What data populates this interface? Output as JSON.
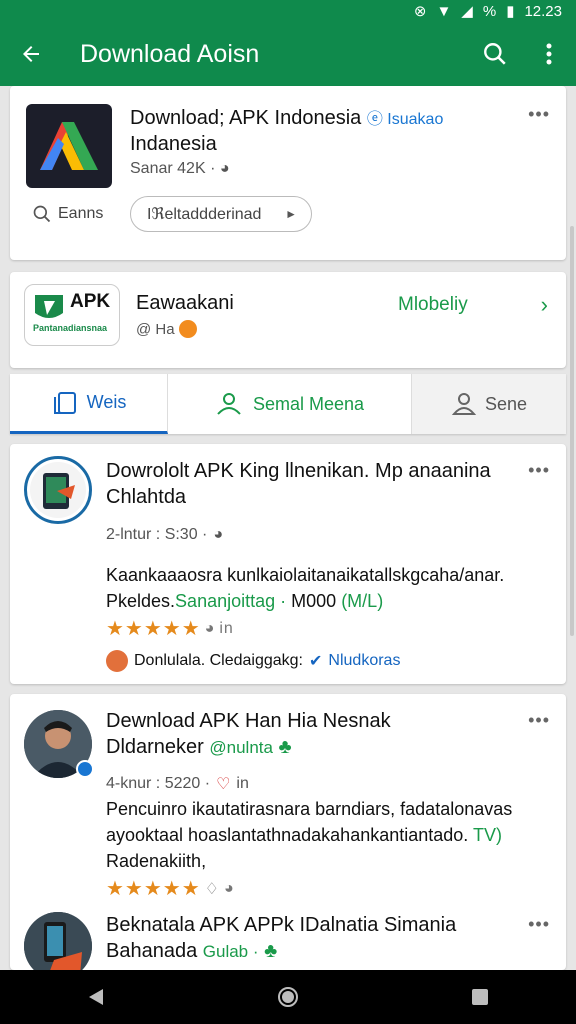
{
  "status_bar": {
    "time": "12.23",
    "battery_label": "%"
  },
  "app_bar": {
    "title": "Download Aoisn"
  },
  "app_card": {
    "name_line1": "Download; APK Indonesia",
    "badge_text": "Isuakao",
    "name_line2": "Indanesia",
    "meta": "Sanar 42K",
    "search_label": "Eanns",
    "chip_label": "Iℜeltaddderinad"
  },
  "brand_card": {
    "logo_text": "APK",
    "logo_subtext": "Pantanadiansnaa",
    "name": "Eawaakani",
    "sub": "@ Ha",
    "right_label": "Mlobeliy"
  },
  "tabs": [
    {
      "label": "Weis"
    },
    {
      "label": "Semal Meena"
    },
    {
      "label": "Sene"
    }
  ],
  "posts": [
    {
      "title_line1": "Dowrololt APK King llnenikan. Mp anaanina",
      "title_line2": "Chlahtda",
      "meta": "2-lntur : S:30 ·",
      "body_line1": "Kaankaaaosra kunlkaiolaitanaikatallskgcaha/anar.",
      "body_line2_pre": "Pkeldes.",
      "body_line2_green": "Sananjoittag ·",
      "body_line2_post": "M000",
      "body_line2_tail": "(M/L)",
      "stars": "★★★★★",
      "stars_tail": "in",
      "footer_text": "Donlulala. Cledaiggakg:",
      "footer_link": "Nludkoras"
    },
    {
      "title_line1": "Dewnload APK Han Hia Nesnak",
      "title_line2_pre": "Dldarneker",
      "title_line2_green": "@nulnta",
      "meta": "4-knur : 5220 ·",
      "meta_tail": "in",
      "body_line1": "Pencuinro ikautatirasnara barndiars, fadatalonavas",
      "body_line2": "ayooktaal hoaslantathnadakahankantiantado.",
      "body_line2_green": "TV)",
      "body_line3": "Radenakiith,",
      "stars": "★★★★★"
    },
    {
      "title_line1": "Beknatala APK APPk IDalnatia Simania",
      "title_line2_pre": "Bahanada",
      "title_line2_green": "Gulab ·"
    }
  ],
  "colors": {
    "brand_green": "#0f8a4c",
    "accent_green": "#1a9a4a",
    "link_blue": "#1565c0",
    "star_orange": "#e58a1c"
  }
}
